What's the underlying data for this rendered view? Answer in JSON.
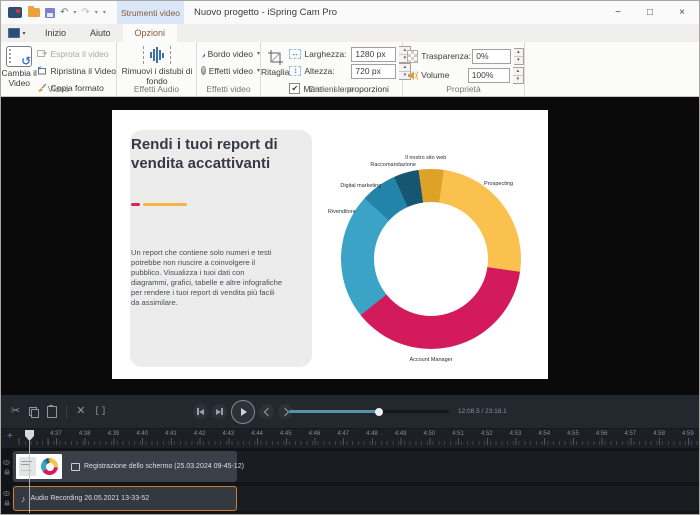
{
  "window": {
    "title": "Nuovo progetto - iSpring Cam Pro",
    "contextual_tab_group": "Strumenti video"
  },
  "icons": {
    "caret_down": "▾",
    "undo": "↶",
    "redo": "↷",
    "minimize": "−",
    "maximize": "□",
    "close": "×",
    "scissors": "✂",
    "delete": "✕",
    "trim": "[]",
    "check": "✔",
    "width_arrow": "↔",
    "height_arrow": "↕",
    "plus": "+",
    "music_note": "♪",
    "crop_pen": "✎"
  },
  "ribbon": {
    "tabs": [
      {
        "label": "Inizio",
        "active": false
      },
      {
        "label": "Aiuto",
        "active": false
      },
      {
        "label": "Opzioni",
        "active": true
      }
    ],
    "video_group": {
      "label": "Video",
      "change_video": "Cambia il Video",
      "export_video": "Esprota il video",
      "restore_video": "Ripristina il Video",
      "copy_format": "Copia formato"
    },
    "audio_group": {
      "label": "Effetti Audio",
      "remove_noise": "Rimuovi i distubi di fondo"
    },
    "video_effects_group": {
      "label": "Effetti video",
      "border_video": "Bordo video",
      "effects_video": "Effetti video"
    },
    "dimension_group": {
      "label": "Dimensione",
      "crop": "Ritaglia",
      "width_label": "Larghezza:",
      "width_value": "1280 px",
      "height_label": "Altezza:",
      "height_value": "720 px",
      "keep_proportions": "Mantieni le proporzioni"
    },
    "properties_group": {
      "label": "Proprietà",
      "transparency_label": "Trasparenza:",
      "transparency_value": "0%",
      "volume_label": "Volume",
      "volume_value": "100%"
    }
  },
  "slide": {
    "title": "Rendi i tuoi report di vendita accattivanti",
    "body": "Un report che contiene solo numeri e testi potrebbe non riuscire a coinvolgere il pubblico. Visualizza i tuoi dati con diagrammi, grafici, tabelle e altre infografiche per rendere i tuoi report di vendita più facili da assimilare.",
    "accent_colors": [
      "#d6245f",
      "#f5b63f"
    ]
  },
  "chart_data": {
    "type": "pie",
    "donut": true,
    "start_angle_deg": -8,
    "inner_radius_ratio": 0.63,
    "slices": [
      {
        "label": "Il nostro sito web",
        "value": 4.5,
        "color": "#dda226",
        "label_angle_deg": 357
      },
      {
        "label": "Prospecting",
        "value": 25,
        "color": "#fac14e",
        "label_angle_deg": 42
      },
      {
        "label": "Account Manager",
        "value": 37,
        "color": "#d31a5b",
        "label_angle_deg": 180
      },
      {
        "label": "Rivenditore",
        "value": 22.5,
        "color": "#3ba3c6",
        "label_angle_deg": 298
      },
      {
        "label": "Digital marketing",
        "value": 6.5,
        "color": "#2384a9",
        "label_angle_deg": 316
      },
      {
        "label": "Raccomandazione",
        "value": 4.5,
        "color": "#175672",
        "label_angle_deg": 338
      }
    ]
  },
  "player": {
    "time_display": "12:08.5 / 23:18.1",
    "progress_percent": 56
  },
  "timeline": {
    "ruler_labels": [
      "4:37",
      "4:38",
      "4:39",
      "4:40",
      "4:41",
      "4:42",
      "4:43",
      "4:44",
      "4:45",
      "4:46",
      "4:47",
      "4:48",
      "4:49",
      "4:50",
      "4:51",
      "4:52",
      "4:53",
      "4:54",
      "4:55",
      "4:56",
      "4:57",
      "4:58",
      "4:59"
    ],
    "tracks": [
      {
        "type": "video",
        "label": "Registrazione dello schermo (25.03.2024 09-45-12)",
        "selected": false
      },
      {
        "type": "audio",
        "label": "Audio Recording 26.05.2021 13-33-52",
        "selected": true
      }
    ]
  },
  "colors": {
    "selected_clip_border": "#c9803f",
    "slider_fill": "#5593ab"
  }
}
